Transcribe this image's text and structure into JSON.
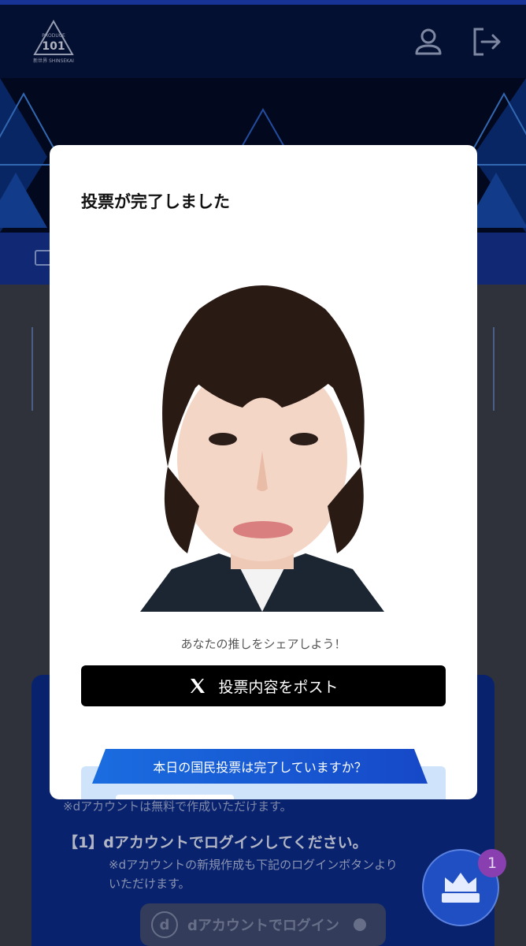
{
  "header": {
    "logo": {
      "line1": "PRODUCE",
      "line2": "101",
      "line3": "新世界 SHINSEKAI"
    },
    "icons": [
      "profile-icon",
      "logout-icon"
    ]
  },
  "background": {
    "note": "※dアカウントは無料で作成いただけます。",
    "heading": "【1】dアカウントでログインしてください。",
    "sub_line1": "※dアカウントの新規作成も下記のログインボタンより",
    "sub_line2": "いただけます。",
    "login_button": "dアカウントでログイン",
    "login_icon_letter": "d"
  },
  "fab": {
    "icon": "crown-icon",
    "badge": "1"
  },
  "modal": {
    "title": "投票が完了しました",
    "share_text": "あなたの推しをシェアしよう！",
    "post_button": "投票内容をポスト",
    "post_icon": "x-logo-icon",
    "ribbon_text": "本日の国民投票は完了していますか？"
  },
  "colors": {
    "header_bg": "#06143e",
    "accent_blue": "#1648c7",
    "modal_bg": "#ffffff",
    "post_button_bg": "#000000",
    "badge": "#8a3fb0"
  }
}
